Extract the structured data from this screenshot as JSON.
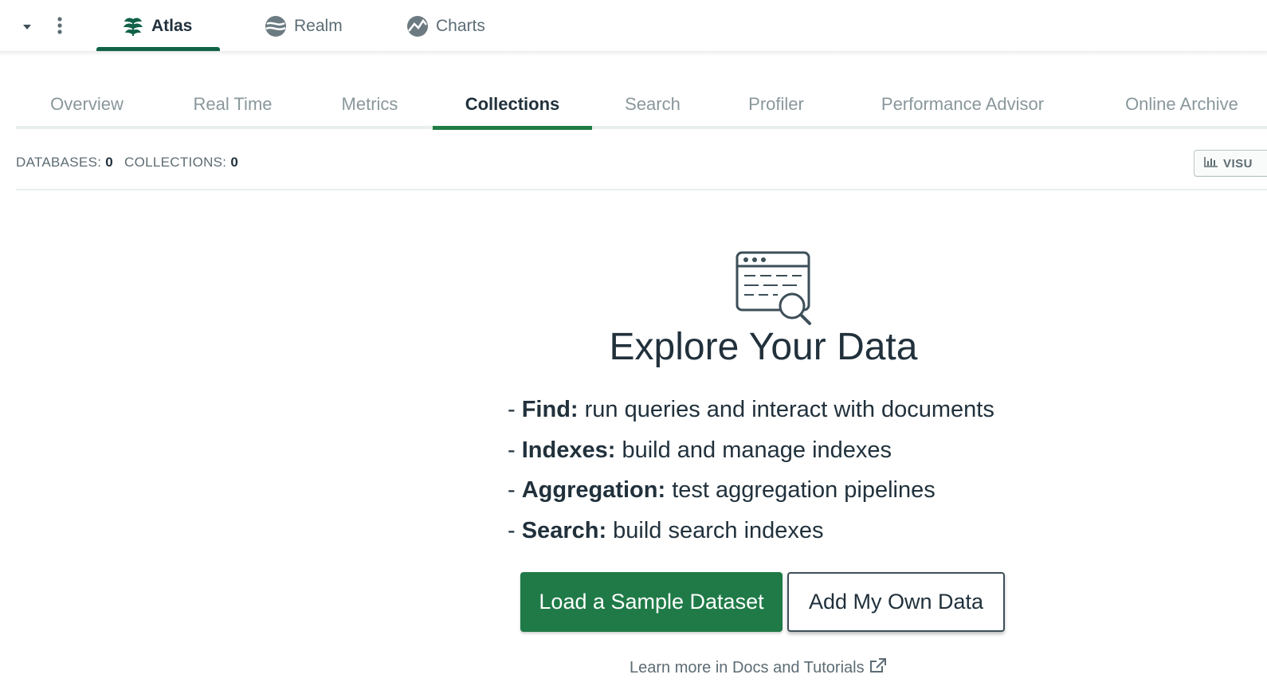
{
  "product_nav": {
    "tabs": [
      {
        "label": "Atlas",
        "icon": "atlas-leaf-icon",
        "active": true
      },
      {
        "label": "Realm",
        "icon": "realm-icon",
        "active": false
      },
      {
        "label": "Charts",
        "icon": "charts-icon",
        "active": false
      }
    ]
  },
  "section_tabs": [
    {
      "label": "Overview",
      "active": false
    },
    {
      "label": "Real Time",
      "active": false
    },
    {
      "label": "Metrics",
      "active": false
    },
    {
      "label": "Collections",
      "active": true
    },
    {
      "label": "Search",
      "active": false
    },
    {
      "label": "Profiler",
      "active": false
    },
    {
      "label": "Performance Advisor",
      "active": false
    },
    {
      "label": "Online Archive",
      "active": false
    }
  ],
  "stats": {
    "databases_label": "DATABASES:",
    "databases_value": "0",
    "collections_label": "COLLECTIONS:",
    "collections_value": "0",
    "visualize_label": "VISU"
  },
  "empty_state": {
    "icon": "browser-search-icon",
    "title": "Explore Your Data",
    "features": [
      {
        "term": "Find:",
        "desc": " run queries and interact with documents"
      },
      {
        "term": "Indexes:",
        "desc": " build and manage indexes"
      },
      {
        "term": "Aggregation:",
        "desc": " test aggregation pipelines"
      },
      {
        "term": "Search:",
        "desc": " build search indexes"
      }
    ],
    "bullet": "- ",
    "primary_button": "Load a Sample Dataset",
    "secondary_button": "Add My Own Data",
    "docs_link": "Learn more in Docs and Tutorials"
  },
  "colors": {
    "brand_green": "#1f7a47",
    "text_dark": "#21313c",
    "text_muted": "#89979b"
  }
}
